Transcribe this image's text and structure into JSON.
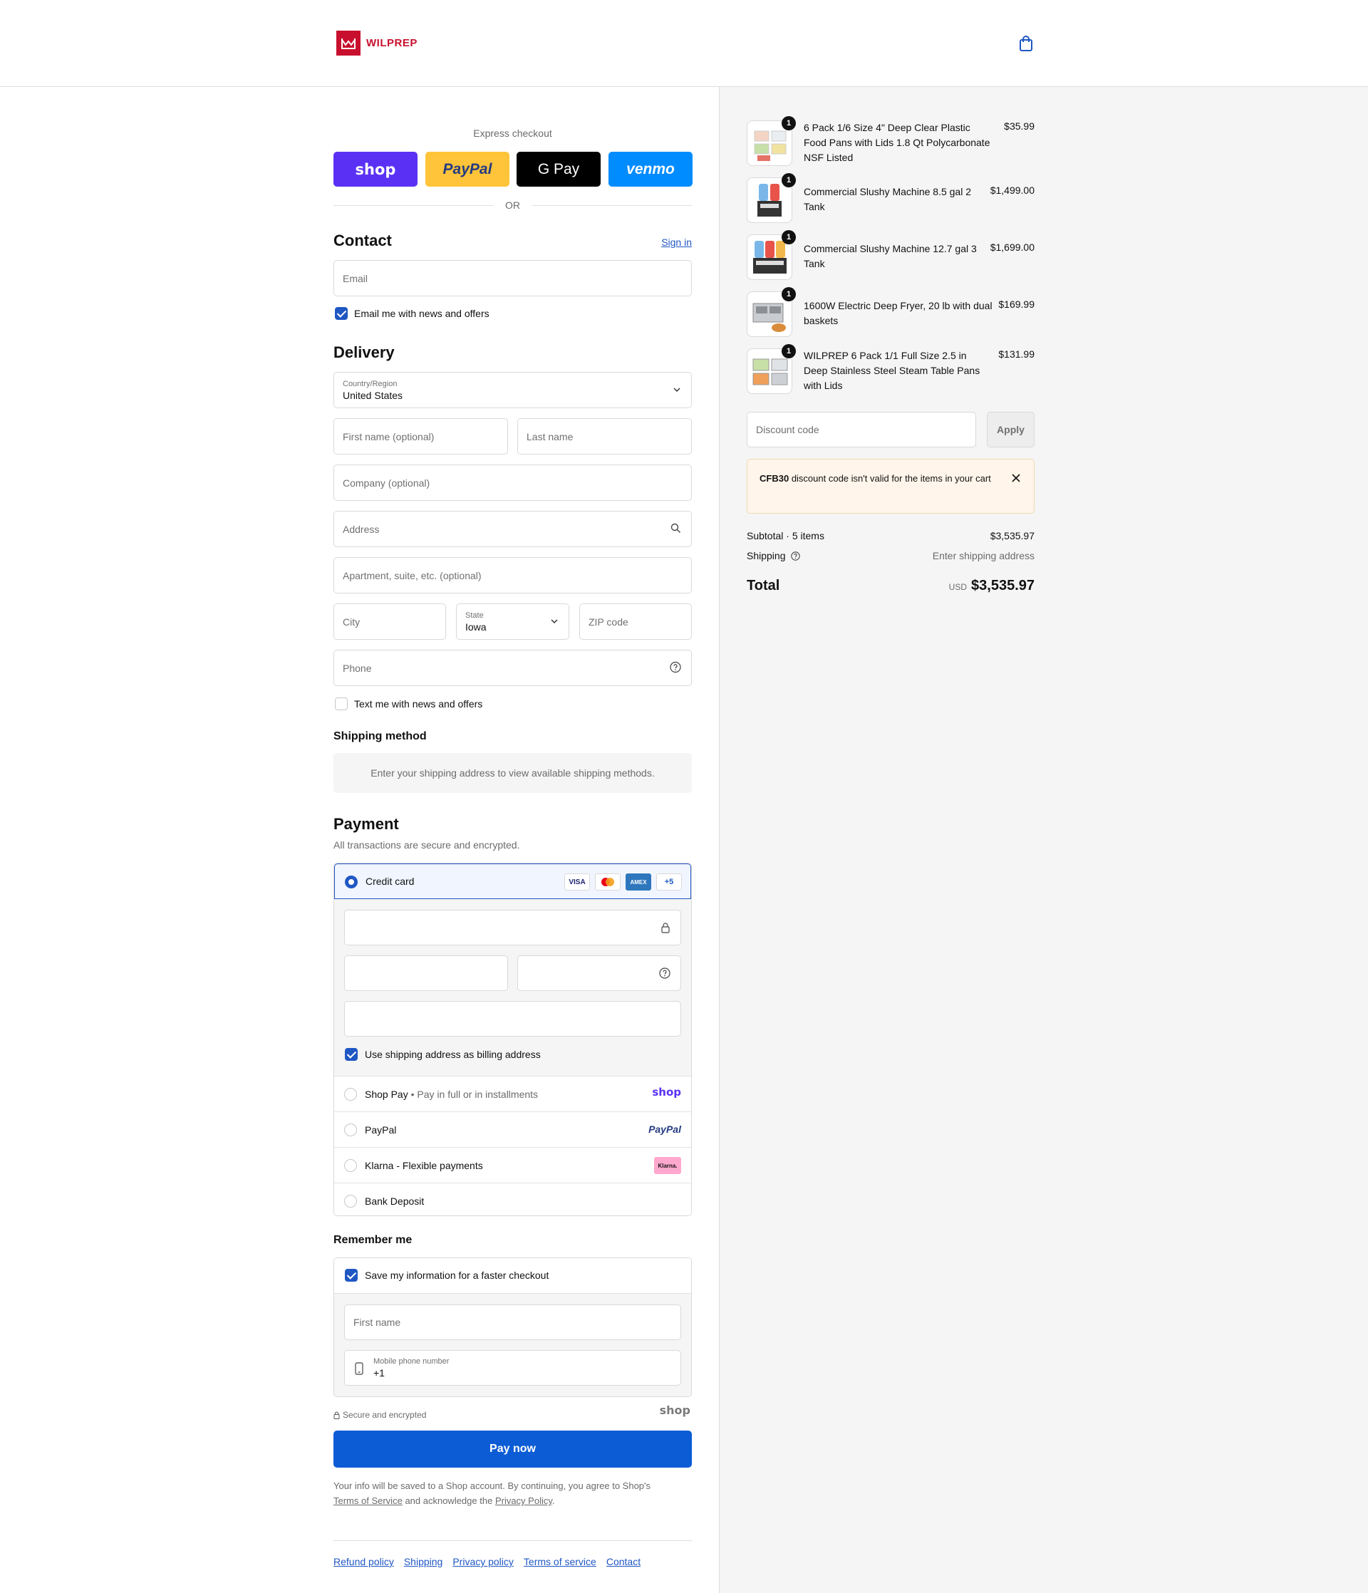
{
  "header": {
    "brand": "WILPREP"
  },
  "express": {
    "label": "Express checkout",
    "buttons": [
      "shop",
      "PayPal",
      "G Pay",
      "venmo"
    ],
    "or": "OR",
    "colors": {
      "shop": "#5a31f4",
      "paypal": "#ffc439",
      "gpay": "#000000",
      "venmo": "#008cff"
    }
  },
  "contact": {
    "title": "Contact",
    "sign_in": "Sign in",
    "email_placeholder": "Email",
    "news_label": "Email me with news and offers"
  },
  "delivery": {
    "title": "Delivery",
    "country_label": "Country/Region",
    "country_value": "United States",
    "first_name": "First name (optional)",
    "last_name": "Last name",
    "company": "Company (optional)",
    "address": "Address",
    "apartment": "Apartment, suite, etc. (optional)",
    "city": "City",
    "state_label": "State",
    "state_value": "Iowa",
    "zip": "ZIP code",
    "phone": "Phone",
    "text_label": "Text me with news and offers"
  },
  "shipping": {
    "title": "Shipping method",
    "message": "Enter your shipping address to view available shipping methods."
  },
  "payment": {
    "title": "Payment",
    "subtitle": "All transactions are secure and encrypted.",
    "credit_card": "Credit card",
    "card_badges": [
      "VISA",
      "",
      "AMEX",
      "+5"
    ],
    "billing_label": "Use shipping address as billing address",
    "shop_pay": "Shop Pay",
    "shop_pay_sub": "Pay in full or in installments",
    "shop_logo": "shop",
    "paypal": "PayPal",
    "paypal_logo": "PayPal",
    "klarna": "Klarna - Flexible payments",
    "klarna_logo": "Klarna.",
    "bank": "Bank Deposit"
  },
  "remember": {
    "title": "Remember me",
    "save_label": "Save my information for a faster checkout",
    "first_name": "First name",
    "mobile_label": "Mobile phone number",
    "mobile_value": "+1",
    "secure": "Secure and encrypted",
    "shop_logo": "shop"
  },
  "pay_now": "Pay now",
  "legal": {
    "text1": "Your info will be saved to a Shop account. By continuing, you agree to Shop's",
    "terms": "Terms of Service",
    "text2": "and acknowledge the",
    "privacy": "Privacy Policy",
    "text3": "."
  },
  "footer": [
    "Refund policy",
    "Shipping",
    "Privacy policy",
    "Terms of service",
    "Contact"
  ],
  "cart": {
    "items": [
      {
        "qty": "1",
        "name": "6 Pack 1/6 Size 4\" Deep Clear Plastic Food Pans with Lids 1.8 Qt Polycarbonate NSF Listed",
        "price": "$35.99"
      },
      {
        "qty": "1",
        "name": "Commercial Slushy Machine 8.5 gal 2 Tank",
        "price": "$1,499.00"
      },
      {
        "qty": "1",
        "name": "Commercial Slushy Machine 12.7 gal 3 Tank",
        "price": "$1,699.00"
      },
      {
        "qty": "1",
        "name": "1600W Electric Deep Fryer, 20 lb with dual baskets",
        "price": "$169.99"
      },
      {
        "qty": "1",
        "name": "WILPREP 6 Pack 1/1 Full Size 2.5 in Deep Stainless Steel Steam Table Pans with Lids",
        "price": "$131.99"
      }
    ],
    "discount_placeholder": "Discount code",
    "apply": "Apply",
    "alert_code": "CFB30",
    "alert_text": "discount code isn't valid for the items in your cart",
    "subtotal_label": "Subtotal · 5 items",
    "subtotal_value": "$3,535.97",
    "shipping_label": "Shipping",
    "shipping_value": "Enter shipping address",
    "total_label": "Total",
    "currency": "USD",
    "total_value": "$3,535.97"
  }
}
